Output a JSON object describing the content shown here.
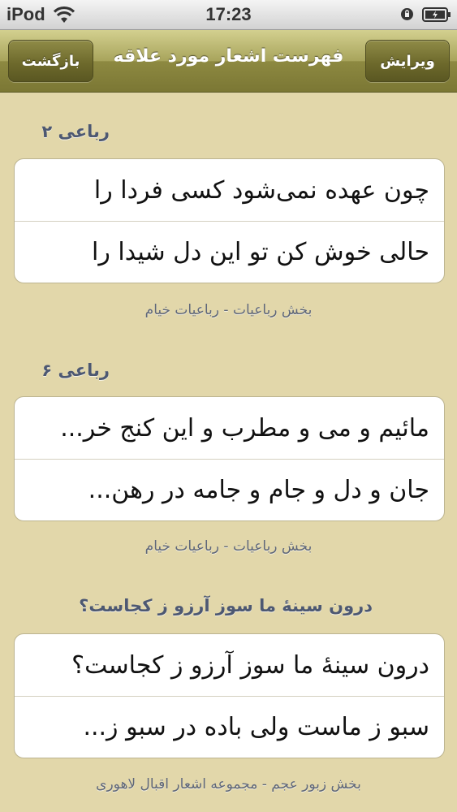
{
  "status": {
    "carrier": "iPod",
    "time": "17:23",
    "icons": [
      "wifi-icon",
      "orientation-lock-icon",
      "battery-icon"
    ]
  },
  "nav": {
    "title": "فهرست اشعار مورد علاقه",
    "back_label": "بازگشت",
    "edit_label": "ویرایش"
  },
  "colors": {
    "background": "#e2d7aa",
    "nav_bar": "#a8a45c",
    "section_header": "#4d5872",
    "footer_text": "#5f6779"
  },
  "poems": [
    {
      "title": "رباعی ۲",
      "lines": [
        "چون عهده نمی‌شود کسی فردا را",
        "حالی خوش کن تو این دل شیدا را"
      ],
      "source": "بخش رباعیات - رباعیات خیام"
    },
    {
      "title": "رباعی ۶",
      "lines": [
        "مائیم و می و مطرب و این کنج خر...",
        "جان و دل و جام و جامه در رهن..."
      ],
      "source": "بخش رباعیات - رباعیات خیام"
    },
    {
      "title": "درون سینهٔ ما سوز آرزو ز کجاست؟",
      "lines": [
        "درون سینهٔ ما سوز آرزو ز کجاست؟",
        "سبو ز ماست ولی باده در سبو ز..."
      ],
      "source": "بخش زبور عجم - مجموعه اشعار اقبال لاهوری"
    }
  ]
}
